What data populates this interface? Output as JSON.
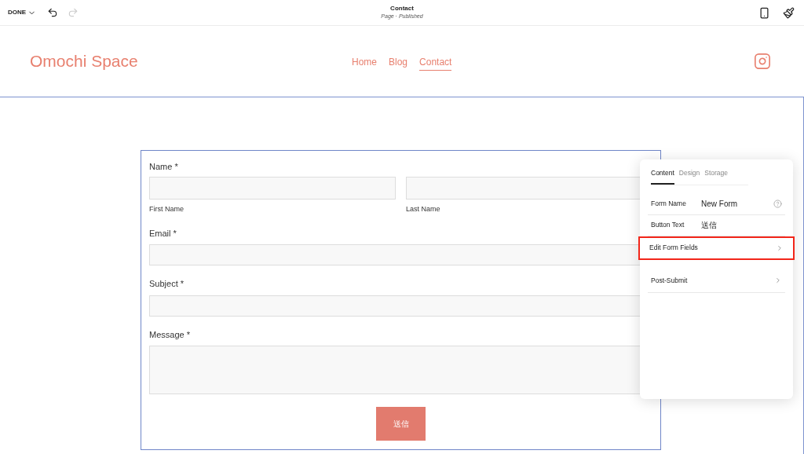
{
  "toolbar": {
    "done": "DONE",
    "title": "Contact",
    "subtitle": "Page · Published"
  },
  "site": {
    "logo": "Omochi Space",
    "nav": [
      {
        "label": "Home",
        "selected": false
      },
      {
        "label": "Blog",
        "selected": false
      },
      {
        "label": "Contact",
        "selected": true
      }
    ]
  },
  "form": {
    "name_label": "Name *",
    "name_fields": [
      {
        "caption": "First Name"
      },
      {
        "caption": "Last Name"
      }
    ],
    "fields": [
      {
        "label": "Email *",
        "kind": "line"
      },
      {
        "label": "Subject *",
        "kind": "line"
      },
      {
        "label": "Message *",
        "kind": "area"
      }
    ],
    "submit": "送信"
  },
  "panel": {
    "tabs": [
      {
        "label": "Content",
        "selected": true
      },
      {
        "label": "Design",
        "selected": false
      },
      {
        "label": "Storage",
        "selected": false
      }
    ],
    "rows": [
      {
        "kind": "value",
        "label": "Form Name",
        "value": "New Form",
        "help": true,
        "highlighted": false
      },
      {
        "kind": "value",
        "label": "Button Text",
        "value": "送信",
        "help": false,
        "highlighted": false
      },
      {
        "kind": "link",
        "label": "Edit Form Fields",
        "highlighted": true
      },
      {
        "kind": "link",
        "label": "Post-Submit",
        "highlighted": false
      }
    ]
  }
}
